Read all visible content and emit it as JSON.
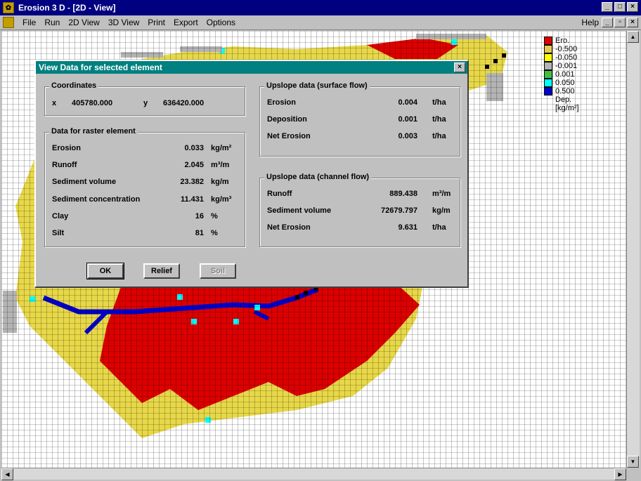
{
  "window": {
    "title": "Erosion 3 D - [2D - View]",
    "buttons": [
      "_",
      "□",
      "×"
    ]
  },
  "menu": {
    "items": [
      "File",
      "Run",
      "2D View",
      "3D View",
      "Print",
      "Export",
      "Options"
    ],
    "help": "Help",
    "mdi_buttons": [
      "_",
      "▫",
      "×"
    ]
  },
  "legend": {
    "title": "Ero.",
    "entries": [
      {
        "label": "-0.500",
        "color": "#dd0000"
      },
      {
        "label": "-0.050",
        "color": "#e8c850"
      },
      {
        "label": "-0.001",
        "color": "#ffff00"
      },
      {
        "label": "0.001",
        "color": "#b4b4b4"
      },
      {
        "label": "0.050",
        "color": "#40c040"
      },
      {
        "label": "0.500",
        "color": "#00ffff"
      },
      {
        "label": "",
        "color": "#0000cc"
      }
    ],
    "footer_1": "Dep.",
    "footer_2": "[kg/m²]"
  },
  "dialog": {
    "title": "View Data for selected element",
    "close": "×",
    "coordinates": {
      "label": "Coordinates",
      "x_label": "x",
      "x_value": "405780.000",
      "y_label": "y",
      "y_value": "636420.000"
    },
    "raster": {
      "label": "Data for raster element",
      "rows": [
        {
          "label": "Erosion",
          "value": "0.033",
          "unit": "kg/m²"
        },
        {
          "label": "Runoff",
          "value": "2.045",
          "unit": "m³/m"
        },
        {
          "label": "Sediment volume",
          "value": "23.382",
          "unit": "kg/m"
        },
        {
          "label": "Sediment concentration",
          "value": "11.431",
          "unit": "kg/m³"
        },
        {
          "label": "Clay",
          "value": "16",
          "unit": "%"
        },
        {
          "label": "Silt",
          "value": "81",
          "unit": "%"
        }
      ]
    },
    "surface": {
      "label": "Upslope data (surface flow)",
      "rows": [
        {
          "label": "Erosion",
          "value": "0.004",
          "unit": "t/ha"
        },
        {
          "label": "Deposition",
          "value": "0.001",
          "unit": "t/ha"
        },
        {
          "label": "Net Erosion",
          "value": "0.003",
          "unit": "t/ha"
        }
      ]
    },
    "channel": {
      "label": "Upslope data (channel flow)",
      "rows": [
        {
          "label": "Runoff",
          "value": "889.438",
          "unit": "m³/m"
        },
        {
          "label": "Sediment volume",
          "value": "72679.797",
          "unit": "kg/m"
        },
        {
          "label": "Net Erosion",
          "value": "9.631",
          "unit": "t/ha"
        }
      ]
    },
    "buttons": {
      "ok": "OK",
      "relief": "Relief",
      "soil": "Soil"
    }
  }
}
